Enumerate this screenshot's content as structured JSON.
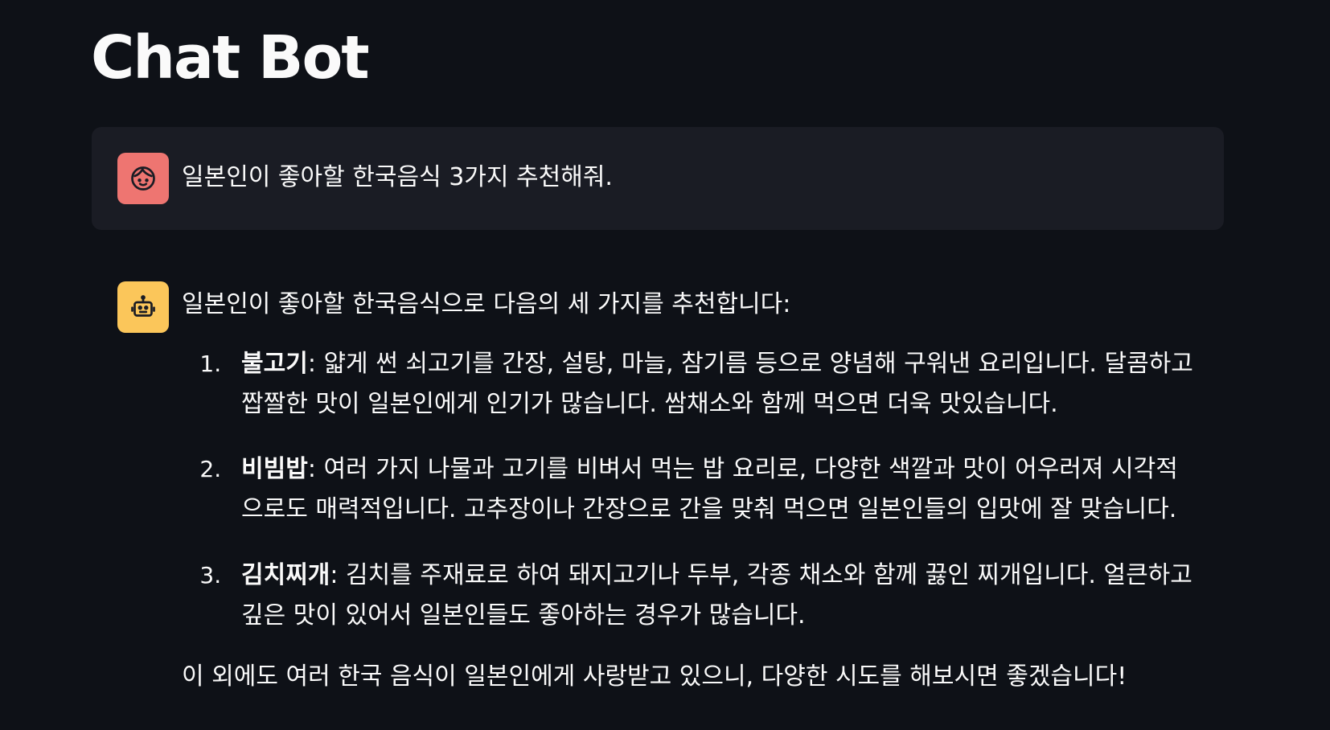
{
  "page": {
    "title": "Chat Bot"
  },
  "messages": {
    "user": {
      "avatar_icon": "face-icon",
      "text": "일본인이 좋아할 한국음식 3가지 추천해줘."
    },
    "assistant": {
      "avatar_icon": "robot-icon",
      "intro": "일본인이 좋아할 한국음식으로 다음의 세 가지를 추천합니다:",
      "items": [
        {
          "name": "불고기",
          "desc": ": 얇게 썬 쇠고기를 간장, 설탕, 마늘, 참기름 등으로 양념해 구워낸 요리입니다. 달콤하고 짭짤한 맛이 일본인에게 인기가 많습니다. 쌈채소와 함께 먹으면 더욱 맛있습니다."
        },
        {
          "name": "비빔밥",
          "desc": ": 여러 가지 나물과 고기를 비벼서 먹는 밥 요리로, 다양한 색깔과 맛이 어우러져 시각적으로도 매력적입니다. 고추장이나 간장으로 간을 맞춰 먹으면 일본인들의 입맛에 잘 맞습니다."
        },
        {
          "name": "김치찌개",
          "desc": ": 김치를 주재료로 하여 돼지고기나 두부, 각종 채소와 함께 끓인 찌개입니다. 얼큰하고 깊은 맛이 있어서 일본인들도 좋아하는 경우가 많습니다."
        }
      ],
      "closing": "이 외에도 여러 한국 음식이 일본인에게 사랑받고 있으니, 다양한 시도를 해보시면 좋겠습니다!"
    }
  },
  "colors": {
    "background": "#0e1117",
    "user_bubble": "#1a1c24",
    "user_avatar": "#ee7571",
    "bot_avatar": "#fbc65a",
    "text": "#fafafa"
  }
}
